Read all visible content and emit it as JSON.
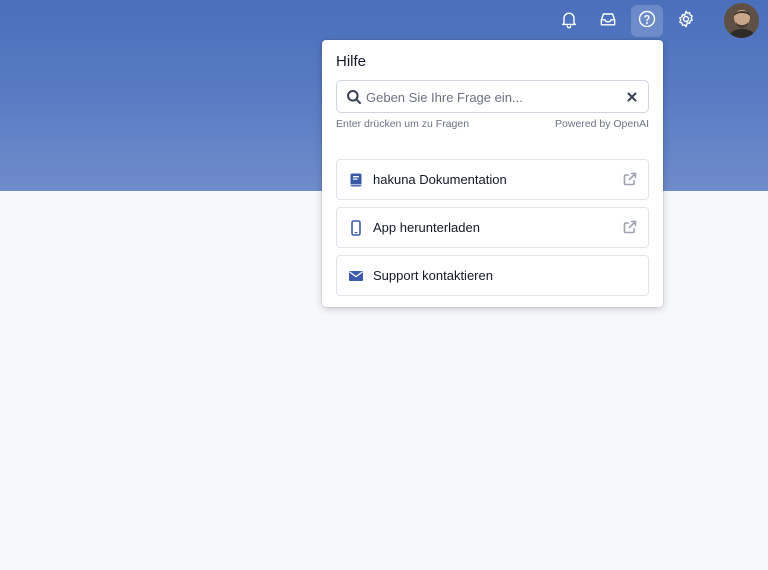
{
  "topbar": {
    "icons": [
      "bell-icon",
      "inbox-icon",
      "help-icon",
      "gear-icon"
    ],
    "active_icon": "help-icon",
    "avatar_alt": "user-avatar"
  },
  "help_panel": {
    "title": "Hilfe",
    "search": {
      "placeholder": "Geben Sie Ihre Frage ein...",
      "value": ""
    },
    "hint": "Enter drücken um zu Fragen",
    "powered_by": "Powered by OpenAI",
    "links": [
      {
        "label": "hakuna Dokumentation",
        "icon": "book-icon",
        "external": true
      },
      {
        "label": "App herunterladen",
        "icon": "smartphone-icon",
        "external": true
      },
      {
        "label": "Support kontaktieren",
        "icon": "envelope-icon",
        "external": false
      }
    ]
  },
  "colors": {
    "header_top": "#4a6fbc",
    "header_bottom": "#6f8ccb",
    "accent": "#3b5ba9",
    "page_bg": "#f6f8fb"
  }
}
